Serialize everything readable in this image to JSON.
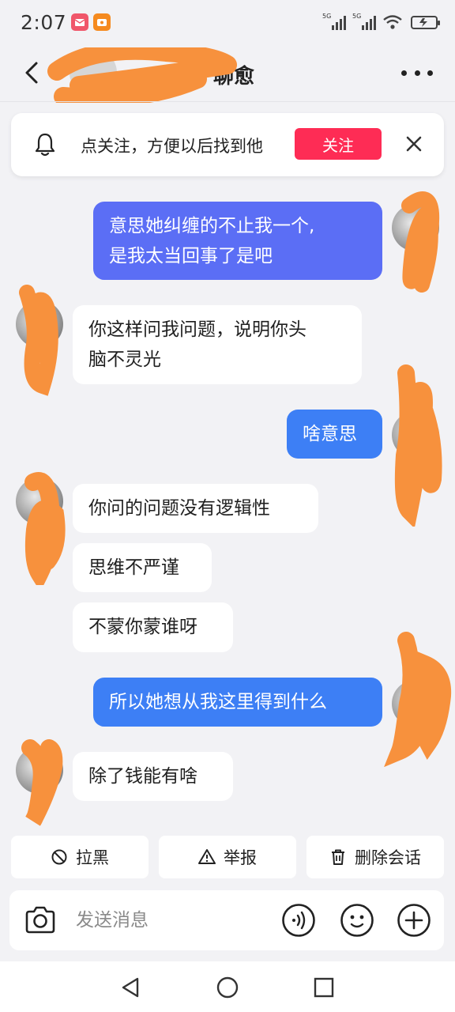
{
  "status_bar": {
    "time": "2:07",
    "network_1": "5G",
    "network_2": "5G"
  },
  "header": {
    "title_visible": "聊愈"
  },
  "follow_banner": {
    "text": "点关注，方便以后找到他",
    "button": "关注"
  },
  "messages": [
    {
      "dir": "out",
      "text_line1": "意思她纠缠的不止我一个,",
      "text_line2": "是我太当回事了是吧"
    },
    {
      "dir": "in",
      "text_line1": "你这样问我问题，说明你头",
      "text_line2": "脑不灵光"
    },
    {
      "dir": "out",
      "text": "啥意思"
    },
    {
      "dir": "in",
      "text": "你问的问题没有逻辑性"
    },
    {
      "dir": "in",
      "text": "思维不严谨"
    },
    {
      "dir": "in",
      "text": "不蒙你蒙谁呀"
    },
    {
      "dir": "out",
      "text": "所以她想从我这里得到什么"
    },
    {
      "dir": "in",
      "text": "除了钱能有啥"
    }
  ],
  "actions": {
    "block": "拉黑",
    "report": "举报",
    "delete": "删除会话"
  },
  "composer": {
    "placeholder": "发送消息"
  },
  "icons": {
    "back": "chevron-left-icon",
    "more": "more-dots-icon",
    "bell": "bell-icon",
    "close": "close-icon",
    "camera": "camera-icon",
    "voice": "voice-icon",
    "emoji": "emoji-icon",
    "plus": "plus-icon"
  },
  "colors": {
    "outgoing_bubble": "#3d7ff5",
    "follow_button": "#fe2c55",
    "redaction": "#f7913d"
  }
}
